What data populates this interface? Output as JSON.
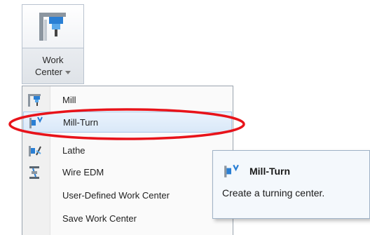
{
  "ribbon": {
    "icon": "work-center-icon",
    "label_line1": "Work",
    "label_line2": "Center"
  },
  "menu": {
    "items": [
      {
        "label": "Mill",
        "icon": "mill-icon"
      },
      {
        "label": "Mill-Turn",
        "icon": "mill-turn-icon"
      },
      {
        "label": "Lathe",
        "icon": "lathe-icon"
      },
      {
        "label": "Wire EDM",
        "icon": "wire-edm-icon"
      },
      {
        "label": "User-Defined Work Center",
        "icon": ""
      },
      {
        "label": "Save Work Center",
        "icon": ""
      }
    ],
    "highlighted": "Mill-Turn"
  },
  "tooltip": {
    "title": "Mill-Turn",
    "description": "Create a turning center.",
    "icon": "mill-turn-icon"
  },
  "colors": {
    "annotation": "#e8131a",
    "highlight": "#d9e8f8",
    "icon_blue": "#2a7fd4"
  }
}
